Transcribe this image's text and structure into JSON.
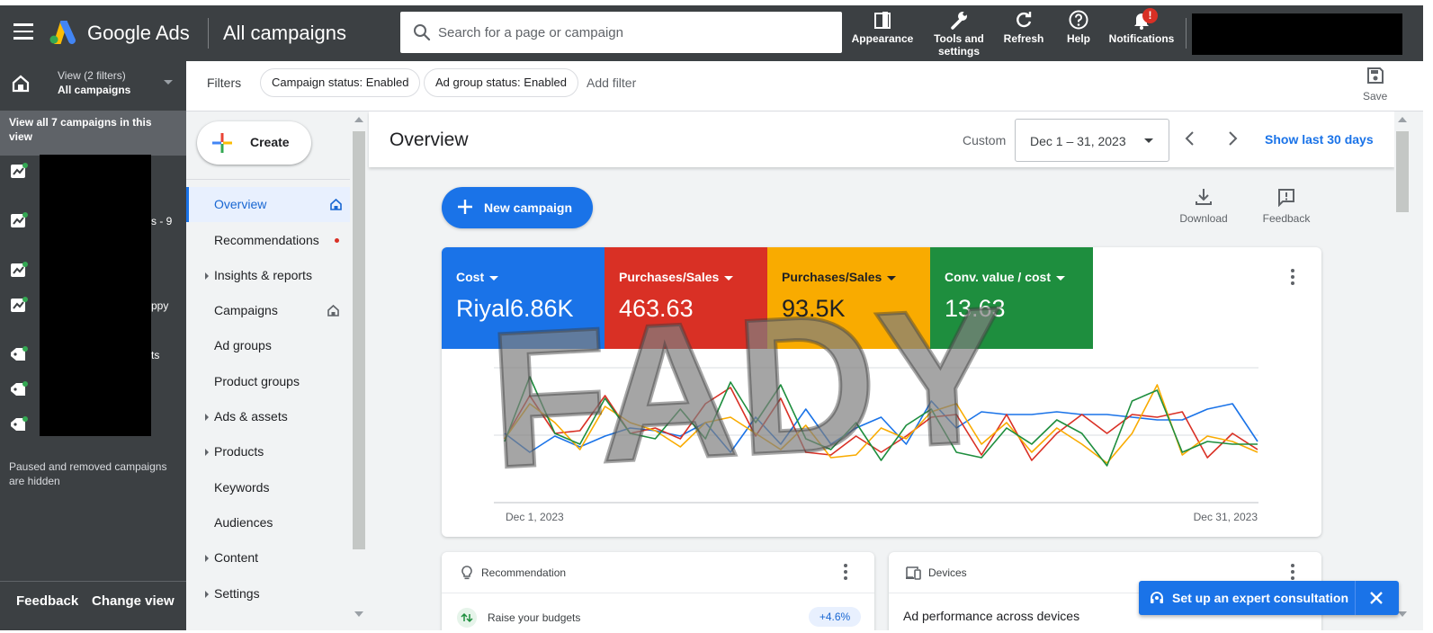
{
  "topbar": {
    "brand": "Google Ads",
    "page_title": "All campaigns",
    "search_placeholder": "Search for a page or campaign",
    "buttons": {
      "appearance": "Appearance",
      "tools_line1": "Tools and",
      "tools_line2": "settings",
      "refresh": "Refresh",
      "help": "Help",
      "notifications": "Notifications"
    },
    "notification_badge": "!"
  },
  "leftpanel": {
    "view_label": "View (2 filters)",
    "view_value": "All campaigns",
    "view_all": "View all 7 campaigns in this view",
    "campaign_fragments": [
      "s - 9",
      "ppy",
      "ts"
    ],
    "hidden_note": "Paused and removed campaigns are hidden",
    "feedback": "Feedback",
    "change_view": "Change view"
  },
  "filterbar": {
    "label": "Filters",
    "chips": [
      "Campaign status: Enabled",
      "Ad group status: Enabled"
    ],
    "add_filter": "Add filter",
    "save": "Save"
  },
  "nav": {
    "create": "Create",
    "items": [
      {
        "label": "Overview"
      },
      {
        "label": "Recommendations"
      },
      {
        "label": "Insights & reports"
      },
      {
        "label": "Campaigns"
      },
      {
        "label": "Ad groups"
      },
      {
        "label": "Product groups"
      },
      {
        "label": "Ads & assets"
      },
      {
        "label": "Products"
      },
      {
        "label": "Keywords"
      },
      {
        "label": "Audiences"
      },
      {
        "label": "Content"
      },
      {
        "label": "Settings"
      }
    ]
  },
  "overview": {
    "title": "Overview",
    "custom_label": "Custom",
    "date_range": "Dec 1 – 31, 2023",
    "show_last": "Show last 30 days",
    "new_campaign": "New campaign",
    "download": "Download",
    "feedback": "Feedback",
    "metrics": [
      {
        "name": "Cost",
        "value": "Riyal6.86K",
        "color": "#1a73e8"
      },
      {
        "name": "Purchases/Sales",
        "value": "463.63",
        "color": "#d93025"
      },
      {
        "name": "Purchases/Sales",
        "value": "93.5K",
        "color": "#f9ab00"
      },
      {
        "name": "Conv. value / cost",
        "value": "13.63",
        "color": "#1e8e3e"
      }
    ],
    "watermark": "FADY",
    "recommendation_card": {
      "title": "Recommendation",
      "item": "Raise your budgets",
      "badge": "+4.6%"
    },
    "devices_card": {
      "title": "Devices",
      "subtitle": "Ad performance across devices"
    },
    "expert_banner": "Set up an expert consultation"
  },
  "chart_data": {
    "type": "line",
    "x_start_label": "Dec 1, 2023",
    "x_end_label": "Dec 31, 2023",
    "grid": true,
    "series": [
      {
        "name": "Cost",
        "color": "#1a73e8",
        "values": [
          0.44,
          0.3,
          0.42,
          0.34,
          0.42,
          0.48,
          0.46,
          0.42,
          0.52,
          0.3,
          0.56,
          0.36,
          0.62,
          0.36,
          0.48,
          0.56,
          0.36,
          0.68,
          0.48,
          0.6,
          0.58,
          0.58,
          0.6,
          0.58,
          0.58,
          0.56,
          0.54,
          0.54,
          0.62,
          0.66,
          0.38
        ]
      },
      {
        "name": "Purchases/Sales",
        "color": "#d93025",
        "values": [
          0.4,
          0.72,
          0.44,
          0.46,
          0.72,
          0.44,
          0.48,
          0.4,
          0.66,
          0.78,
          0.42,
          0.7,
          0.3,
          0.28,
          0.42,
          0.3,
          0.42,
          0.56,
          0.58,
          0.28,
          0.58,
          0.24,
          0.44,
          0.58,
          0.44,
          0.58,
          0.56,
          0.6,
          0.26,
          0.44,
          0.32
        ]
      },
      {
        "name": "Purchases/Sales",
        "color": "#f9ab00",
        "values": [
          0.4,
          0.66,
          0.52,
          0.32,
          0.64,
          0.52,
          0.46,
          0.34,
          0.52,
          0.56,
          0.44,
          0.32,
          0.5,
          0.26,
          0.28,
          0.48,
          0.4,
          0.6,
          0.66,
          0.36,
          0.52,
          0.3,
          0.48,
          0.36,
          0.22,
          0.44,
          0.8,
          0.28,
          0.42,
          0.38,
          0.3
        ]
      },
      {
        "name": "Conv. value / cost",
        "color": "#1e8e3e",
        "values": [
          0.38,
          0.86,
          0.44,
          0.36,
          0.7,
          0.44,
          0.4,
          0.62,
          0.4,
          0.82,
          0.52,
          0.8,
          0.4,
          0.32,
          0.52,
          0.24,
          0.5,
          0.62,
          0.3,
          0.26,
          0.48,
          0.36,
          0.54,
          0.44,
          0.2,
          0.68,
          0.76,
          0.3,
          0.38,
          0.36,
          0.36
        ]
      }
    ]
  }
}
